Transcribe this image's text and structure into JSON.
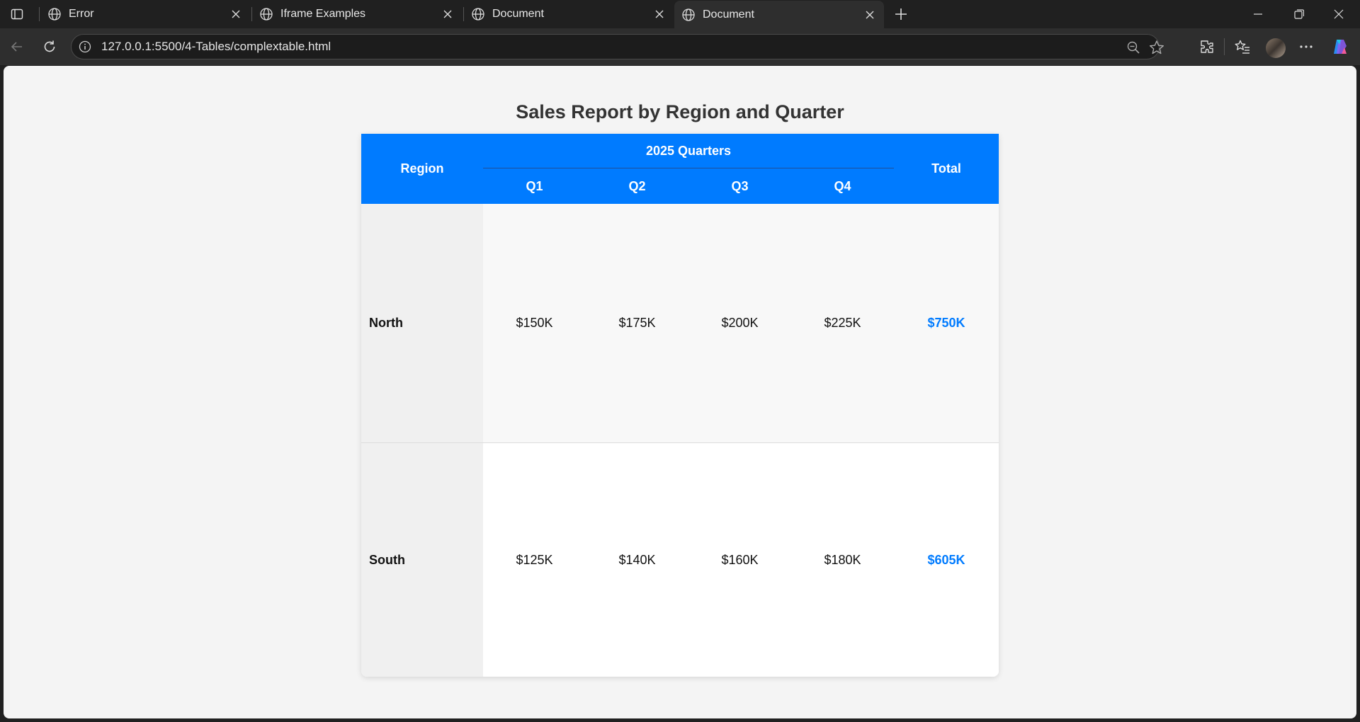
{
  "browser": {
    "tabs": [
      {
        "title": "Error",
        "favicon": "globe-icon",
        "active": false
      },
      {
        "title": "Iframe Examples",
        "favicon": "globe-icon",
        "active": false
      },
      {
        "title": "Document",
        "favicon": "globe-icon",
        "active": false
      },
      {
        "title": "Document",
        "favicon": "globe-icon",
        "active": true
      }
    ],
    "url": "127.0.0.1:5500/4-Tables/complextable.html"
  },
  "page": {
    "title": "Sales Report by Region and Quarter",
    "table": {
      "region_header": "Region",
      "group_header": "2025 Quarters",
      "quarters": [
        "Q1",
        "Q2",
        "Q3",
        "Q4"
      ],
      "total_header": "Total",
      "rows": [
        {
          "region": "North",
          "values": [
            "$150K",
            "$175K",
            "$200K",
            "$225K"
          ],
          "total": "$750K"
        },
        {
          "region": "South",
          "values": [
            "$125K",
            "$140K",
            "$160K",
            "$180K"
          ],
          "total": "$605K"
        }
      ]
    }
  },
  "colors": {
    "header_bg": "#007bff",
    "total_text": "#007bff",
    "page_bg": "#f4f4f4"
  }
}
